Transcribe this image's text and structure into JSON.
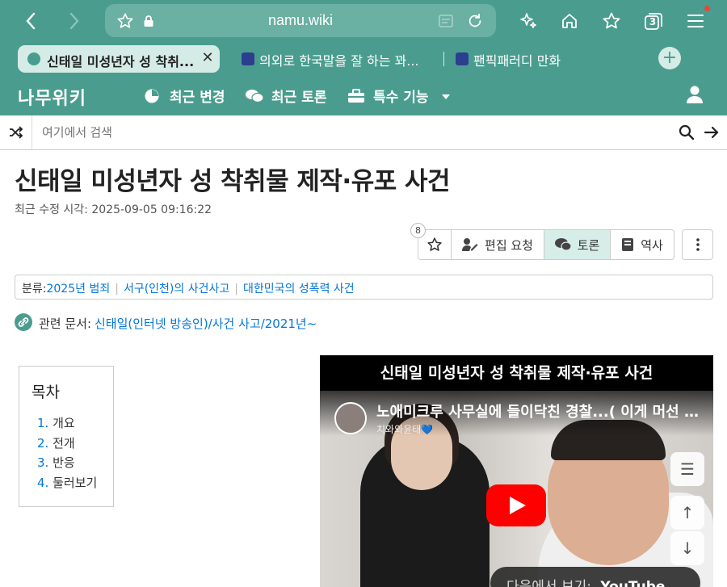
{
  "browser": {
    "url": "namu.wiki",
    "tabs": [
      {
        "title": "신태일 미성년자 성 착취...",
        "active": true
      },
      {
        "title": "의외로 한국말을 잘 하는 꽈...",
        "active": false
      },
      {
        "title": "팬픽패러디 만화",
        "active": false
      }
    ],
    "tab_count": "3",
    "colors": {
      "theme": "#4a9d8e",
      "active_tab": "#d4ebe6",
      "notification": "#e8463b"
    }
  },
  "site": {
    "logo": "나무위키",
    "nav": [
      {
        "label": "최근 변경",
        "icon": "compass-icon"
      },
      {
        "label": "최근 토론",
        "icon": "comments-icon"
      },
      {
        "label": "특수 기능",
        "icon": "toolbox-icon"
      }
    ]
  },
  "search": {
    "placeholder": "여기에서 검색"
  },
  "article": {
    "title": "신태일 미성년자 성 착취물 제작·유포 사건",
    "modified_label": "최근 수정 시각:",
    "modified_time": "2025-09-05 09:16:22",
    "star_count": "8",
    "actions": [
      {
        "label": "편집 요청",
        "icon": "edit-icon"
      },
      {
        "label": "토론",
        "icon": "comments-icon"
      },
      {
        "label": "역사",
        "icon": "book-icon"
      }
    ],
    "category_label": "분류",
    "categories": [
      "2025년 범죄",
      "서구(인천)의 사건사고",
      "대한민국의 성폭력 사건"
    ],
    "related_label": "관련 문서:",
    "related_link": "신태일(인터넷 방송인)/사건 사고/2021년~",
    "toc": {
      "heading": "목차",
      "items": [
        {
          "num": "1.",
          "title": "개요"
        },
        {
          "num": "2.",
          "title": "전개"
        },
        {
          "num": "3.",
          "title": "반응"
        },
        {
          "num": "4.",
          "title": "둘러보기"
        }
      ]
    },
    "video": {
      "caption": "신태일 미성년자 성 착취물 제작·유포 사건",
      "title": "노애미크루 사무실에 들이닥친 경찰...( 이게 머선 일...",
      "channel": "치와와윤태💙",
      "watch_label": "다음에서 보기:",
      "watch_brand": "YouTube"
    }
  }
}
